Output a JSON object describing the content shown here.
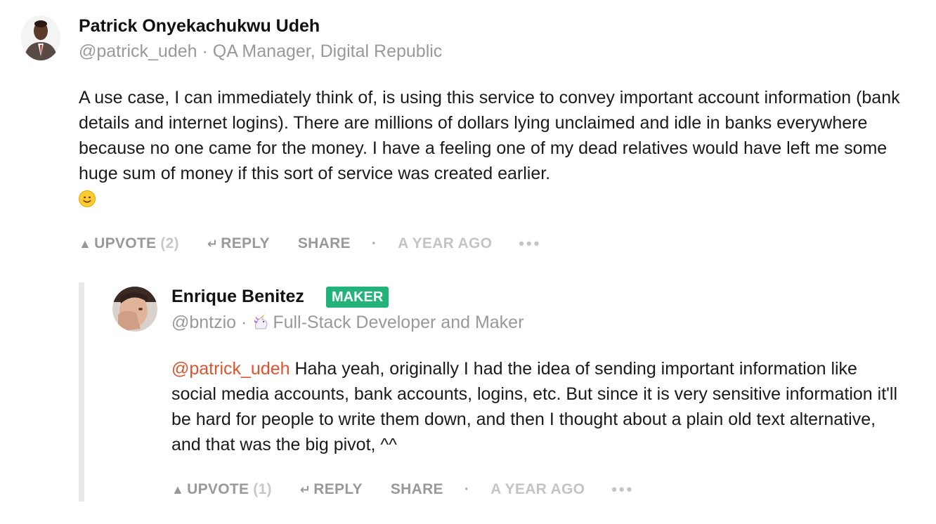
{
  "comments": [
    {
      "author": "Patrick Onyekachukwu Udeh",
      "meta": "@patrick_udeh · QA Manager, Digital Republic",
      "body": "A use case, I can immediately think of, is using this service to convey important account information (bank details and internet logins). There are millions of dollars lying unclaimed and idle in banks everywhere because no one came for the money. I have a feeling one of my dead relatives would have left me some huge sum of money if this sort of service was created earlier.",
      "emoji": "smiling-face",
      "actions": {
        "upvote": "UPVOTE",
        "upvote_count": "(2)",
        "reply": "REPLY",
        "share": "SHARE",
        "separator": "·",
        "time": "A YEAR AGO",
        "more": "•••"
      }
    },
    {
      "author": "Enrique Benitez",
      "badge": "MAKER",
      "handle": "@bntzio · ",
      "headline_emoji": "unicorn",
      "headline": "Full-Stack Developer and Maker",
      "mention": "@patrick_udeh",
      "body": " Haha yeah, originally I had the idea of sending important information like social media accounts, bank accounts, logins, etc. But since it is very sensitive information it'll be hard for people to write them down, and then I thought about a plain old text alternative, and that was the big pivot, ^^",
      "actions": {
        "upvote": "UPVOTE",
        "upvote_count": "(1)",
        "reply": "REPLY",
        "share": "SHARE",
        "separator": "·",
        "time": "A YEAR AGO",
        "more": "•••"
      }
    }
  ],
  "colors": {
    "mention": "#da552f",
    "maker_badge": "#21b37a",
    "muted": "#999999",
    "thread_line": "#e8e8e8"
  }
}
